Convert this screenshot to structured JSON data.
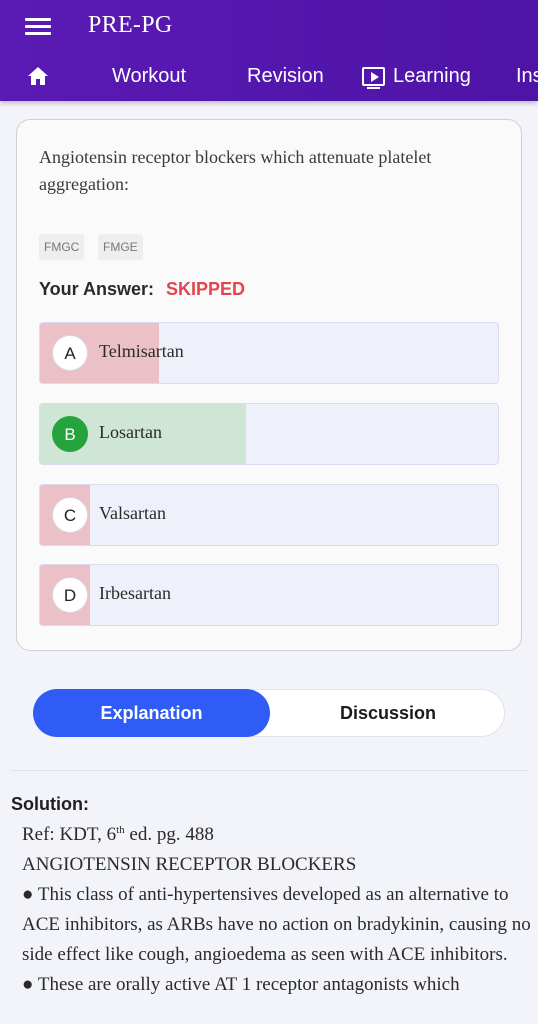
{
  "app": {
    "title": "PRE-PG"
  },
  "nav": {
    "items": [
      {
        "label": "Workout"
      },
      {
        "label": "Revision"
      },
      {
        "label": "Learning"
      },
      {
        "label": "Ins"
      }
    ]
  },
  "question": {
    "text": "Angiotensin receptor blockers which attenuate platelet aggregation:",
    "tags": [
      "FMGC",
      "FMGE"
    ],
    "your_answer_label": "Your Answer:",
    "your_answer_value": "SKIPPED",
    "options": [
      {
        "letter": "A",
        "text": "Telmisartan",
        "status": "wrong",
        "percent": 26
      },
      {
        "letter": "B",
        "text": "Losartan",
        "status": "correct",
        "percent": 45
      },
      {
        "letter": "C",
        "text": "Valsartan",
        "status": "wrong",
        "percent": 11
      },
      {
        "letter": "D",
        "text": "Irbesartan",
        "status": "wrong",
        "percent": 11
      }
    ]
  },
  "tabs": {
    "explanation": "Explanation",
    "discussion": "Discussion"
  },
  "solution": {
    "label": "Solution:",
    "ref_prefix": "Ref: KDT, 6",
    "ref_sup": "th",
    "ref_suffix": " ed. pg. 488",
    "heading": "ANGIOTENSIN RECEPTOR BLOCKERS",
    "bullet1": "● This class of anti-hypertensives developed as an alternative to ACE inhibitors, as ARBs have no action on bradykinin, causing no side effect like cough, angioedema as seen with ACE inhibitors.",
    "bullet2": "● These are orally active AT 1 receptor antagonists which"
  },
  "colors": {
    "header": "#5a1ab4",
    "accent": "#2f5cf7",
    "wrong_fill": "#ebc0c7",
    "correct_fill": "#cfe6d6",
    "skipped": "#e2454f",
    "correct_badge": "#27a33d"
  }
}
